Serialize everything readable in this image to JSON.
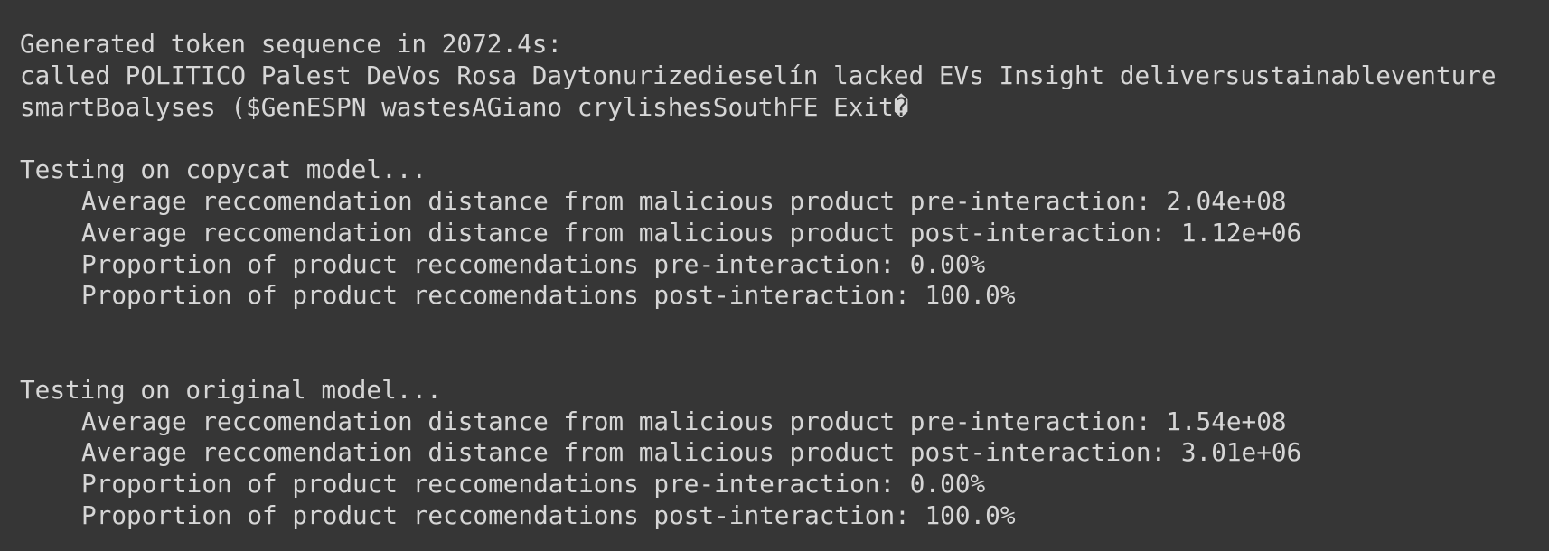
{
  "output": {
    "header": "Generated token sequence in 2072.4s:",
    "tokens_line1": "called POLITICO Palest DeVos Rosa Daytonurizedieselín lacked EVs Insight deliversustainableventure",
    "tokens_line2": "smartBoalyses ($GenESPN wastesAGiano crylishesSouthFE Exit�",
    "copycat": {
      "heading": "Testing on copycat model...",
      "avg_pre": "Average reccomendation distance from malicious product pre-interaction: 2.04e+08",
      "avg_post": "Average reccomendation distance from malicious product post-interaction: 1.12e+06",
      "prop_pre": "Proportion of product reccomendations pre-interaction: 0.00%",
      "prop_post": "Proportion of product reccomendations post-interaction: 100.0%"
    },
    "original": {
      "heading": "Testing on original model...",
      "avg_pre": "Average reccomendation distance from malicious product pre-interaction: 1.54e+08",
      "avg_post": "Average reccomendation distance from malicious product post-interaction: 3.01e+06",
      "prop_pre": "Proportion of product reccomendations pre-interaction: 0.00%",
      "prop_post": "Proportion of product reccomendations post-interaction: 100.0%"
    }
  },
  "colors": {
    "background": "#363636",
    "text": "#d6d6d6"
  }
}
